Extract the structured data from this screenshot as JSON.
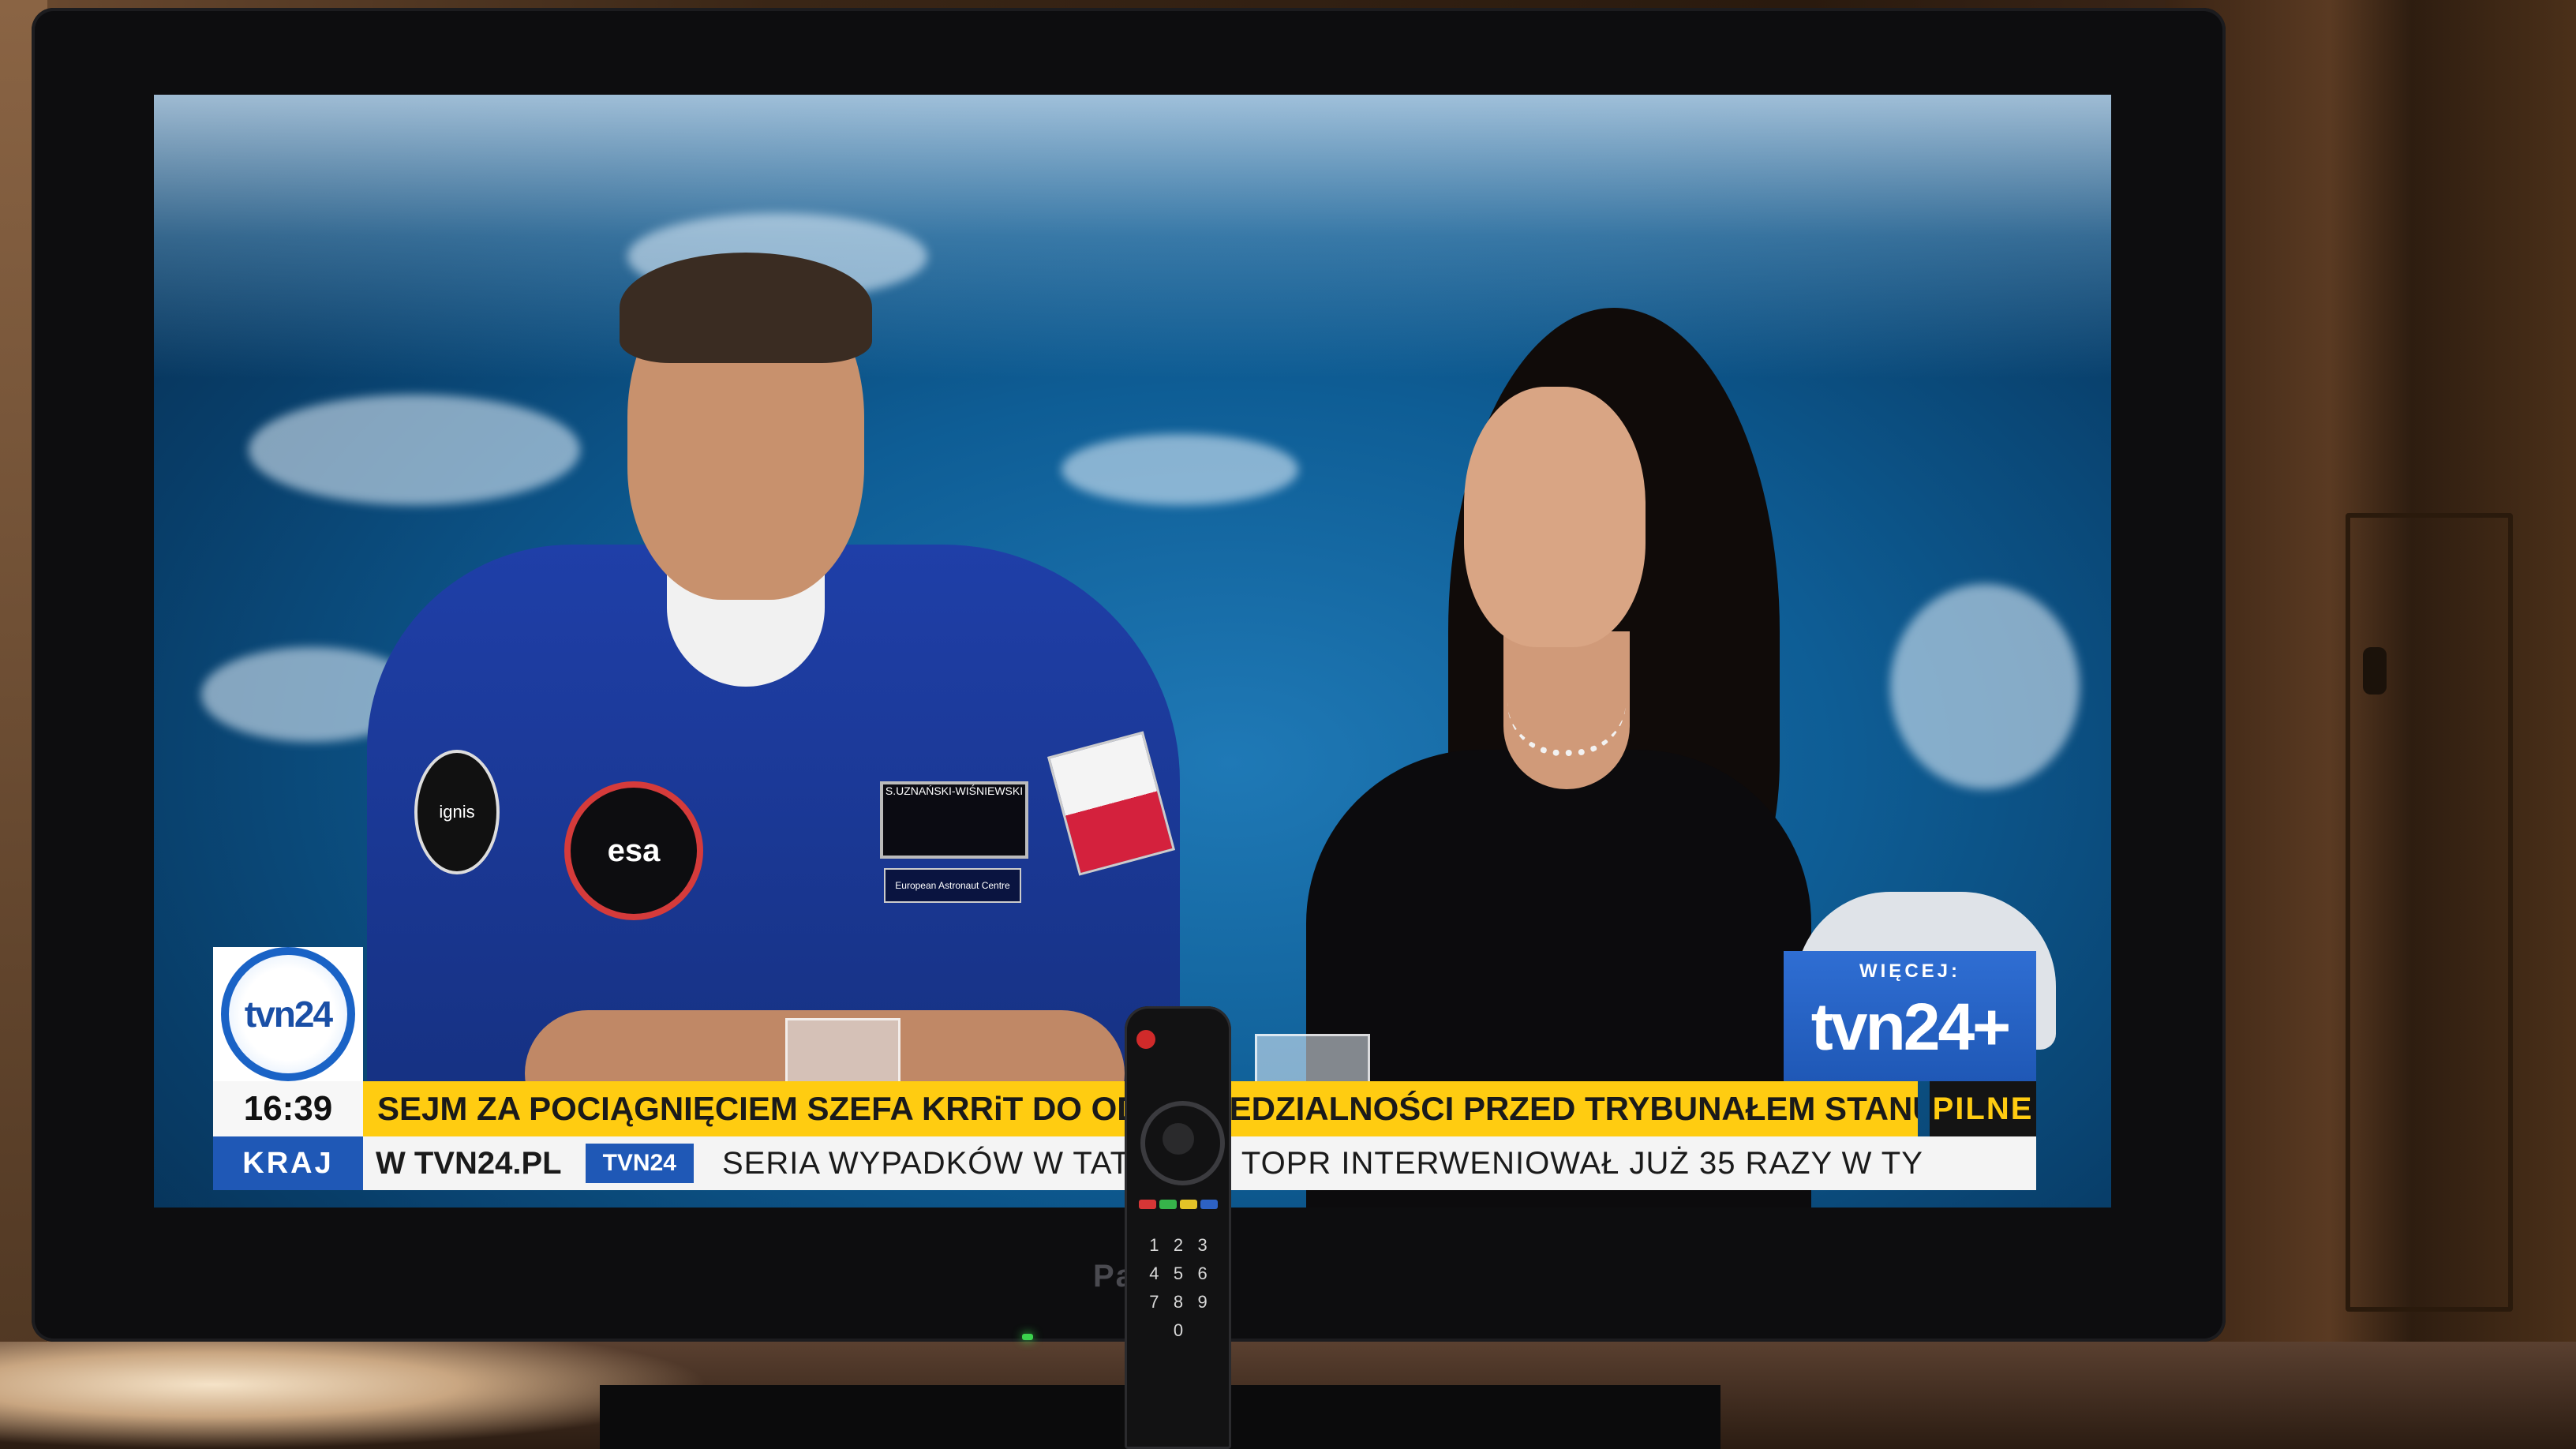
{
  "overlay": {
    "logo_text": "tvn24",
    "more_label": "WIĘCEJ:",
    "more_logo": "tvn24+",
    "time": "16:39",
    "headline": "SEJM ZA POCIĄGNIĘCIEM SZEFA KRRiT DO ODPOWIEDZIALNOŚCI PRZED TRYBUNAŁEM STANU",
    "urgent_label": "PILNE",
    "section_label": "KRAJ",
    "ticker_site": "W TVN24.PL",
    "ticker_badge": "TVN24",
    "ticker_text": "SERIA WYPADKÓW W TATRACH. TOPR INTERWENIOWAŁ JUŻ 35 RAZY W TY"
  },
  "patches": {
    "esa": "esa",
    "ignis": "ignis",
    "name_tag": "S.UZNAŃSKI-WIŚNIEWSKI",
    "eac": "European Astronaut Centre"
  },
  "tv": {
    "brand": "Pana"
  },
  "remote": {
    "keys": [
      "1",
      "2",
      "3",
      "4",
      "5",
      "6",
      "7",
      "8",
      "9",
      "",
      "0",
      ""
    ]
  },
  "colors": {
    "tvn_blue": "#1f58b6",
    "headline_yellow": "#ffcc11",
    "urgent_bg": "#141414"
  }
}
